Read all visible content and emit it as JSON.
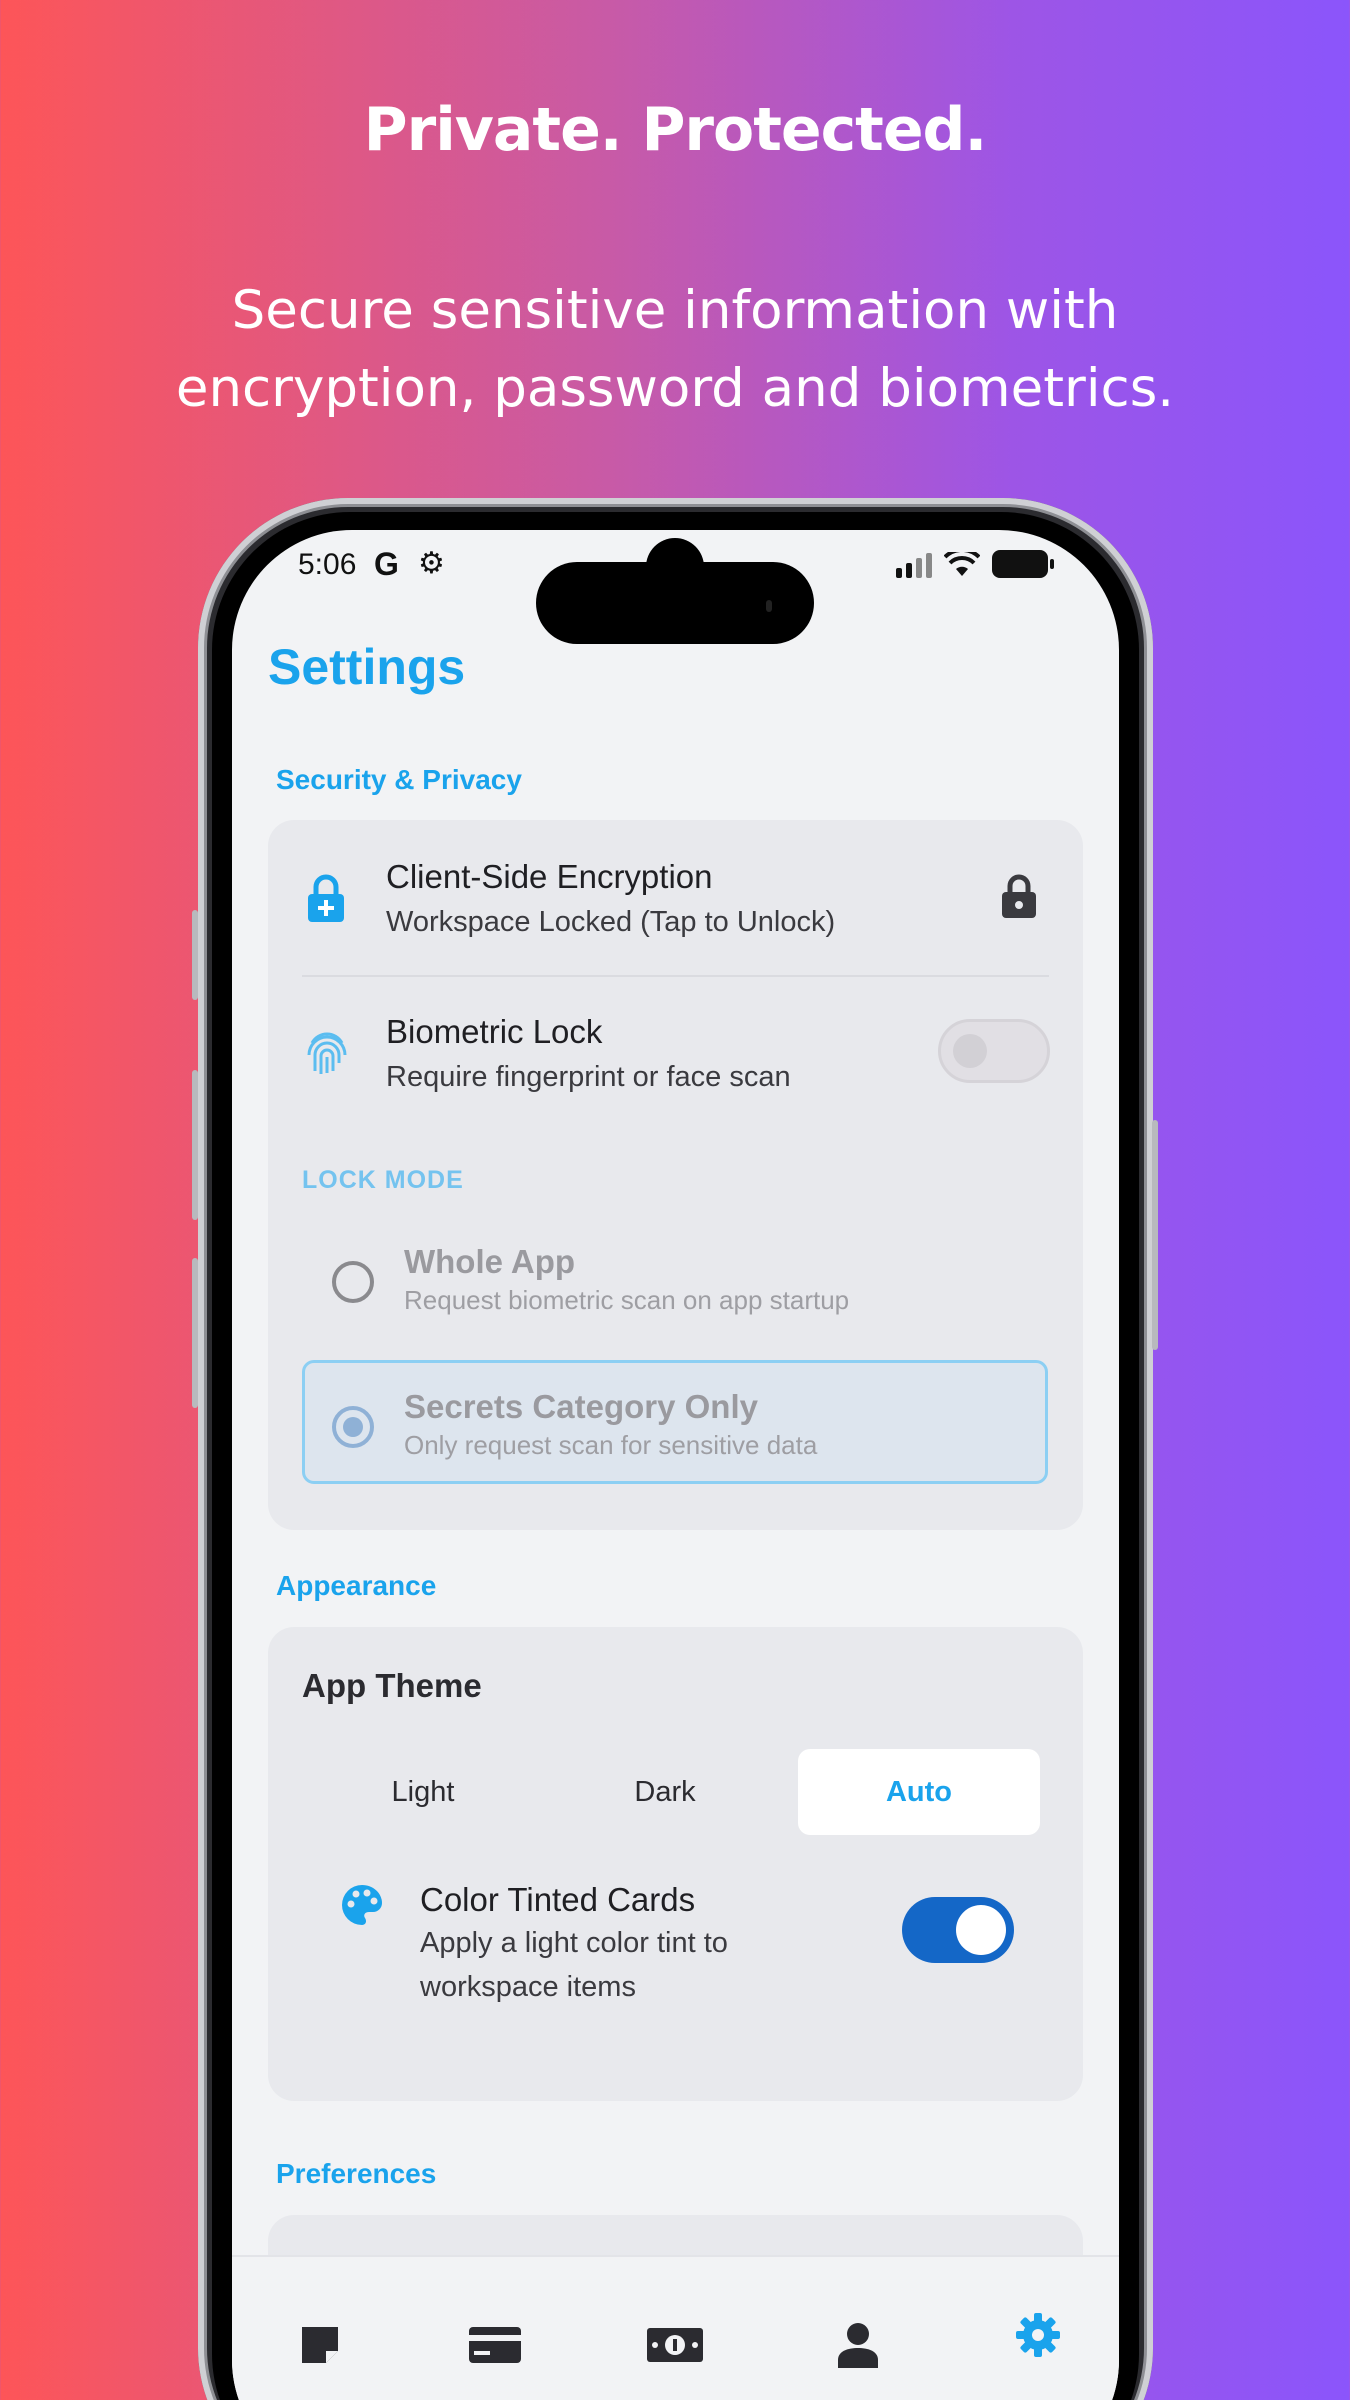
{
  "hero": {
    "headline": "Private. Protected.",
    "subline_1": "Secure sensitive information with",
    "subline_2": "encryption, password and biometrics."
  },
  "status_bar": {
    "time": "5:06",
    "g_glyph": "G"
  },
  "screen": {
    "title": "Settings",
    "security": {
      "section_label": "Security & Privacy",
      "encryption": {
        "title": "Client-Side Encryption",
        "subtitle": "Workspace Locked (Tap to Unlock)"
      },
      "biometric": {
        "title": "Biometric Lock",
        "subtitle": "Require fingerprint or face scan",
        "enabled": false
      },
      "lock_mode_label": "LOCK MODE",
      "lock_mode_options": [
        {
          "title": "Whole App",
          "subtitle": "Request biometric scan on app startup",
          "selected": false
        },
        {
          "title": "Secrets Category Only",
          "subtitle": "Only request scan for sensitive data",
          "selected": true
        }
      ]
    },
    "appearance": {
      "section_label": "Appearance",
      "theme_title": "App Theme",
      "theme_options": [
        "Light",
        "Dark",
        "Auto"
      ],
      "theme_selected": "Auto",
      "tinted": {
        "title": "Color Tinted Cards",
        "subtitle_1": "Apply a light color tint to",
        "subtitle_2": "workspace items",
        "enabled": true
      }
    },
    "preferences": {
      "section_label": "Preferences"
    },
    "tabs": [
      {
        "icon": "note-icon"
      },
      {
        "icon": "credit-card-icon"
      },
      {
        "icon": "money-icon"
      },
      {
        "icon": "person-icon"
      },
      {
        "icon": "settings-gear-icon",
        "active": true
      }
    ]
  },
  "colors": {
    "accent": "#1aa3ec",
    "toggle_on": "#1467c7",
    "gradient_left": "#fd5558",
    "gradient_right": "#8b55fb"
  }
}
